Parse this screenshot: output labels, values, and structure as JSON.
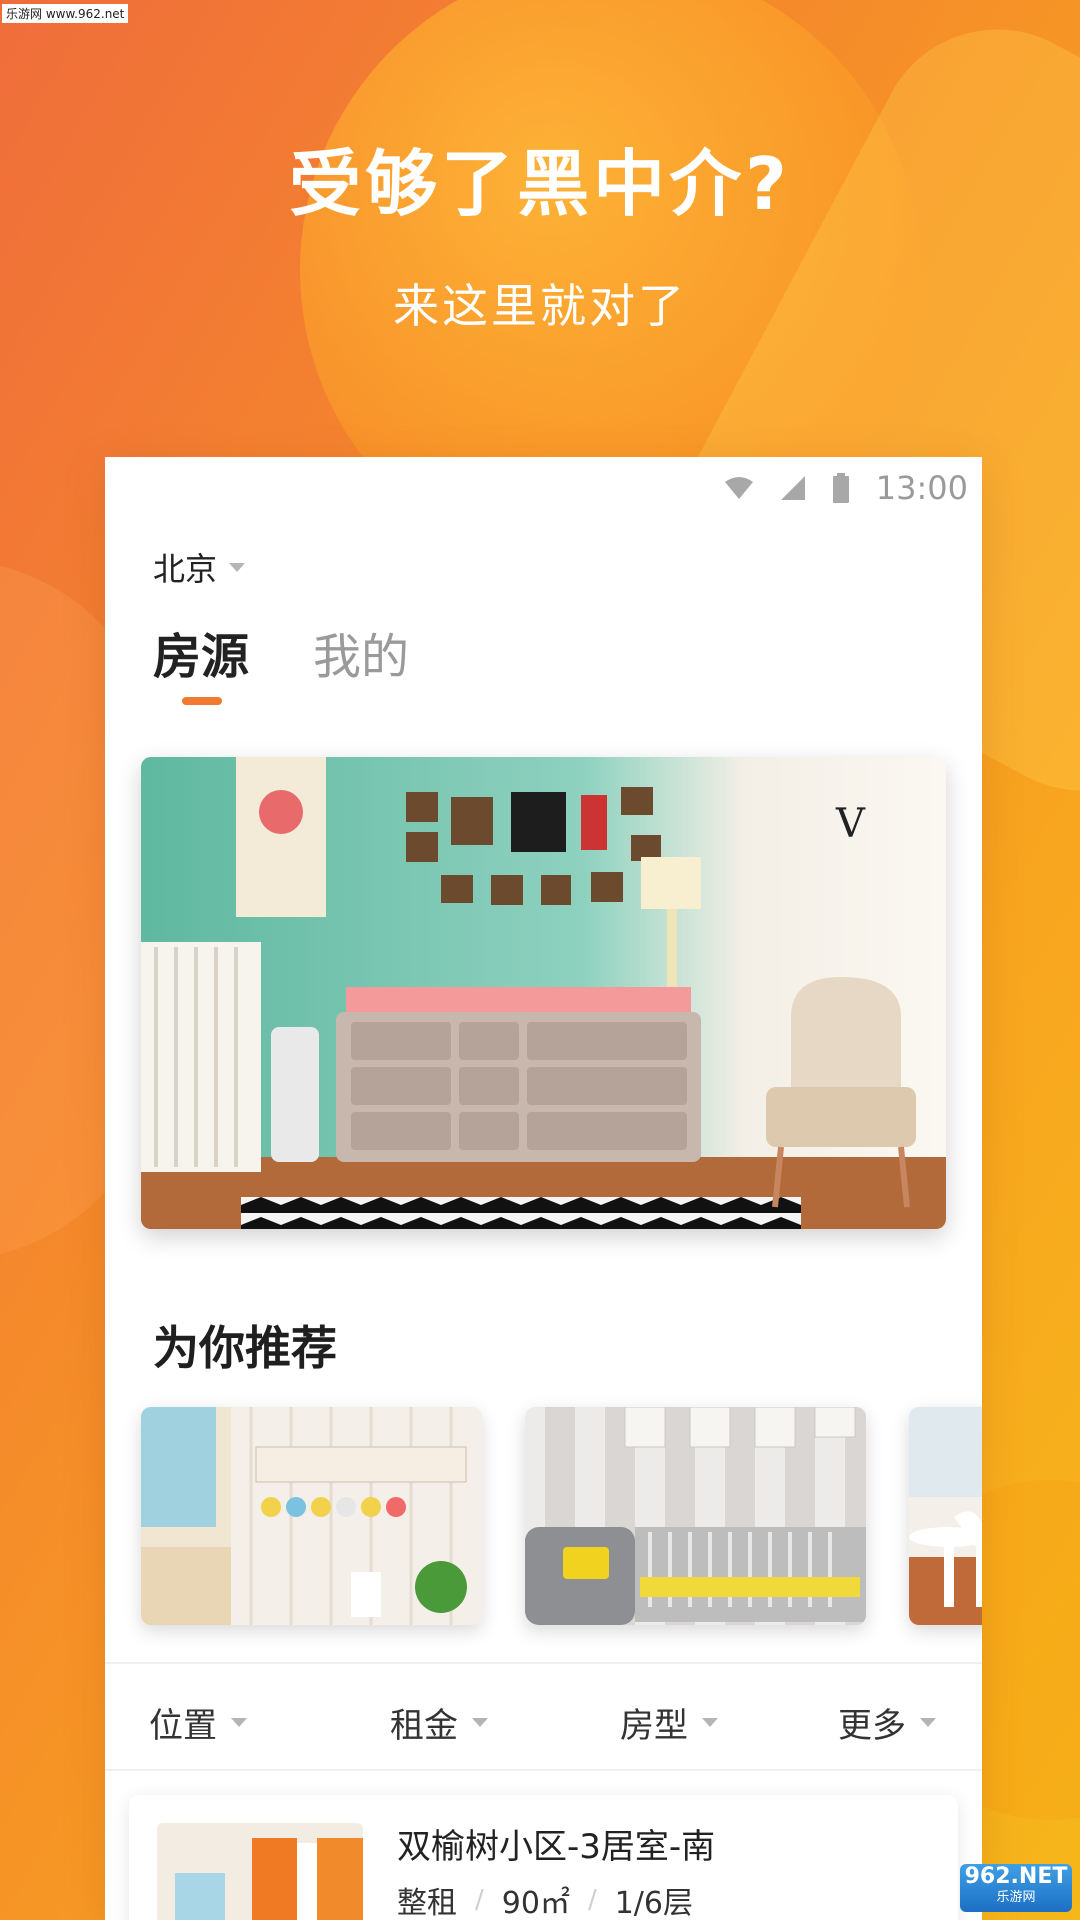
{
  "site_tag": "乐游网 www.962.net",
  "hero": {
    "headline": "受够了黑中介?",
    "subline": "来这里就对了"
  },
  "status_bar": {
    "time": "13:00",
    "icons": [
      "wifi-icon",
      "signal-icon",
      "battery-icon"
    ]
  },
  "city": {
    "name": "北京"
  },
  "tabs": [
    {
      "label": "房源",
      "active": true
    },
    {
      "label": "我的",
      "active": false
    }
  ],
  "banner": {
    "alt": "nursery-room-photo"
  },
  "recommend": {
    "title": "为你推荐",
    "cards": [
      "kitchen-photo",
      "nursery-crib-photo",
      "dining-room-photo"
    ]
  },
  "filters": [
    {
      "label": "位置"
    },
    {
      "label": "租金"
    },
    {
      "label": "房型"
    },
    {
      "label": "更多"
    }
  ],
  "listing": {
    "title": "双榆树小区-3居室-南",
    "type": "整租",
    "area": "90㎡",
    "floor": "1/6层"
  },
  "watermark": {
    "top": "962.NET",
    "bottom": "乐游网"
  },
  "colors": {
    "accent": "#f07a2e",
    "background_start": "#f06d3b",
    "background_end": "#f6b71a"
  }
}
